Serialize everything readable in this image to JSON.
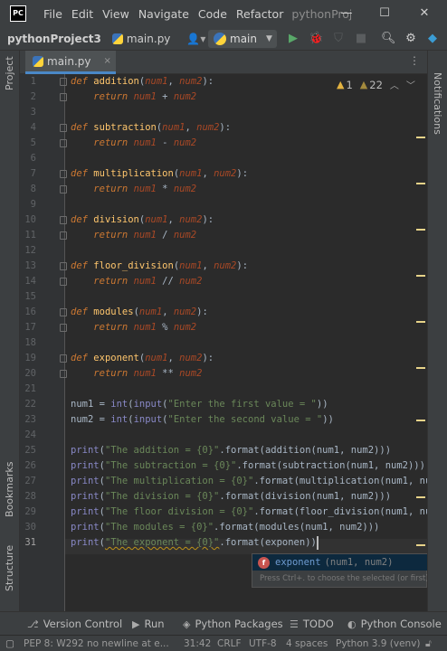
{
  "titlebar": {
    "logo": "PC",
    "menu": [
      "File",
      "Edit",
      "View",
      "Navigate",
      "Code",
      "Refactor"
    ],
    "app_title": "pythonProject",
    "minimize": "—",
    "maximize": "☐",
    "close": "✕"
  },
  "navbar": {
    "project": "pythonProject3",
    "file": "main.py",
    "user": "👤▾",
    "branch": "main",
    "icons": [
      "run-icon",
      "debug-icon",
      "coverage-icon",
      "stop-icon",
      "search-icon",
      "gear-icon",
      "jetbrains-icon"
    ]
  },
  "left_strip": {
    "project": "Project",
    "bookmarks": "Bookmarks",
    "structure": "Structure"
  },
  "right_strip": {
    "notifications": "Notifications"
  },
  "tab": {
    "label": "main.py",
    "close": "×",
    "more": "⋮"
  },
  "inspection": {
    "warnings": "1",
    "weak_warnings": "22"
  },
  "code": {
    "line_numbers": [
      "1",
      "2",
      "3",
      "4",
      "5",
      "6",
      "7",
      "8",
      "9",
      "10",
      "11",
      "12",
      "13",
      "14",
      "15",
      "16",
      "17",
      "18",
      "19",
      "20",
      "21",
      "22",
      "23",
      "24",
      "25",
      "26",
      "27",
      "28",
      "29",
      "30",
      "31"
    ],
    "current_line": 31
  },
  "completion": {
    "icon": "f",
    "name": "exponent",
    "signature": "(num1, num2)",
    "hint": "Press Ctrl+. to choose the selected (or first) sugge"
  },
  "bottom_tools": {
    "version_control": "Version Control",
    "run": "Run",
    "python_packages": "Python Packages",
    "todo": "TODO",
    "python_console": "Python Console"
  },
  "statusbar": {
    "message": "PEP 8: W292 no newline at e...",
    "position": "31:42",
    "line_sep": "CRLF",
    "encoding": "UTF-8",
    "indent": "4 spaces",
    "interpreter": "Python 3.9 (venv)"
  }
}
